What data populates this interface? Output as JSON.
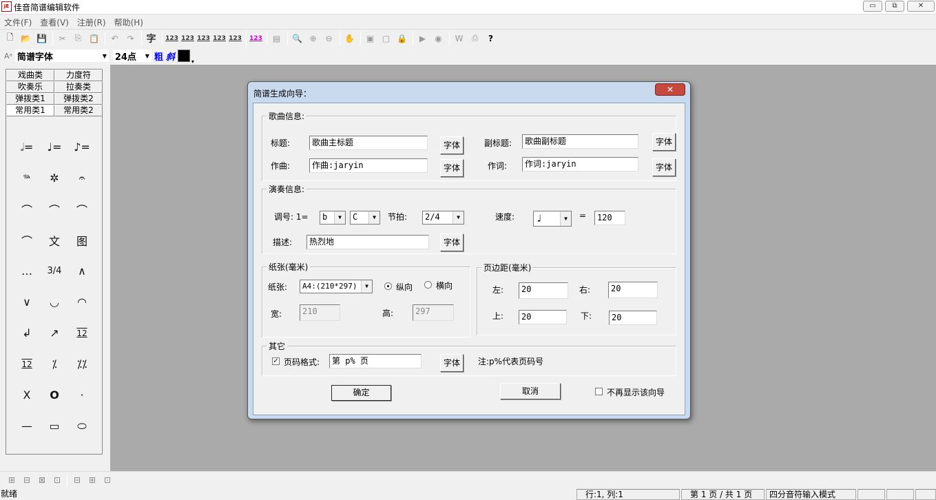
{
  "window": {
    "title": "佳音简谱编辑软件",
    "icon_text": "JE",
    "controls": [
      "▭",
      "⧉",
      "✕"
    ]
  },
  "menu": [
    "文件(F)",
    "查看(V)",
    "注册(R)",
    "帮助(H)"
  ],
  "toolbar": {
    "char_button": "字",
    "num_buttons": [
      "123",
      "123",
      "123",
      "123",
      "123"
    ],
    "num_button_pink": "123"
  },
  "fontbar": {
    "glyph": "Aᵃ",
    "font_name": "简谱字体",
    "font_size": "24点",
    "bold": "粗",
    "italic": "斜",
    "color": "#000000"
  },
  "palette": {
    "tabs": [
      [
        "戏曲类",
        "力度符"
      ],
      [
        "吹奏乐",
        "拉奏类"
      ],
      [
        "弹拨类1",
        "弹拨类2"
      ],
      [
        "常用类1",
        "常用类2"
      ]
    ],
    "symbols": [
      "𝅗𝅥=",
      "♩=",
      "♪=",
      "𝆮",
      "✲",
      "𝄐",
      "⌒",
      "⌒",
      "⌒",
      "⌒",
      "文",
      "图",
      "…",
      "3/4",
      "∧",
      "∨",
      "◡",
      "◠",
      "↲",
      "↗",
      "12",
      "12",
      "⁒",
      "⁒⁒",
      "X",
      "O",
      "·",
      "—",
      "▭",
      "⬭"
    ]
  },
  "bottom_tools": [
    "⊞",
    "⊟",
    "⊠",
    "⊡",
    "⊟",
    "⊞",
    "⊡"
  ],
  "status": {
    "ready": "就绪",
    "position": "行:1, 列:1",
    "page": "第 1 页 / 共 1 页",
    "mode": "四分音符输入模式"
  },
  "dialog": {
    "title": "简谱生成向导：",
    "close": "✕",
    "song_info": {
      "label": "歌曲信息:",
      "title_label": "标题:",
      "title_value": "歌曲主标题",
      "subtitle_label": "副标题:",
      "subtitle_value": "歌曲副标题",
      "composer_label": "作曲:",
      "composer_value": "作曲:jaryin",
      "lyricist_label": "作词:",
      "lyricist_value": "作词:jaryin",
      "font_button": "字体"
    },
    "performance": {
      "label": "演奏信息:",
      "key_label": "调号: 1=",
      "key_accidental": "b",
      "key_note": "C",
      "meter_label": "节拍:",
      "meter_value": "2/4",
      "tempo_label": "速度:",
      "tempo_note": "♩",
      "equals": "=",
      "tempo_value": "120",
      "desc_label": "描述:",
      "desc_value": "热烈地",
      "font_button": "字体"
    },
    "paper": {
      "label": "纸张(毫米)",
      "paper_label": "纸张:",
      "paper_value": "A4:(210*297)",
      "portrait": "纵向",
      "landscape": "横向",
      "width_label": "宽:",
      "width_value": "210",
      "height_label": "高:",
      "height_value": "297"
    },
    "margins": {
      "label": "页边距(毫米)",
      "left_label": "左:",
      "left_value": "20",
      "right_label": "右:",
      "right_value": "20",
      "top_label": "上:",
      "top_value": "20",
      "bottom_label": "下:",
      "bottom_value": "20"
    },
    "other": {
      "label": "其它",
      "page_format_label": "页码格式:",
      "page_format_checked": true,
      "page_format_value": "第 p% 页",
      "font_button": "字体",
      "note": "注:p%代表页码号"
    },
    "ok": "确定",
    "cancel": "取消",
    "dont_show": "不再显示该向导"
  }
}
